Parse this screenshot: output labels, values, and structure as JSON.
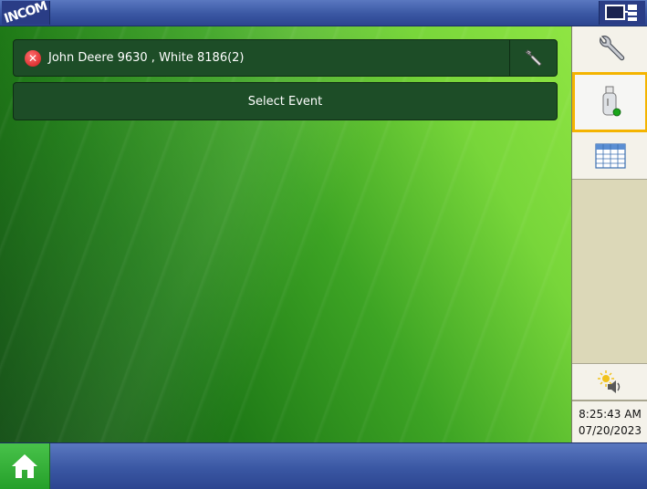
{
  "header": {
    "logo_text": "INCOM"
  },
  "config": {
    "label": "John Deere 9630 , White 8186(2)",
    "status": "error"
  },
  "event": {
    "label": "Select Event"
  },
  "sidebar": {
    "buttons": [
      {
        "name": "tools",
        "icon": "wrench-icon"
      },
      {
        "name": "usb",
        "icon": "usb-drive-icon",
        "selected": true
      },
      {
        "name": "data",
        "icon": "table-icon"
      },
      {
        "name": "display-settings",
        "icon": "brightness-volume-icon"
      }
    ],
    "time": "8:25:43 AM",
    "date": "07/20/2023"
  },
  "colors": {
    "accent_select": "#f4b400",
    "bar_blue": "#3a57a3",
    "home_green": "#25a02a"
  }
}
